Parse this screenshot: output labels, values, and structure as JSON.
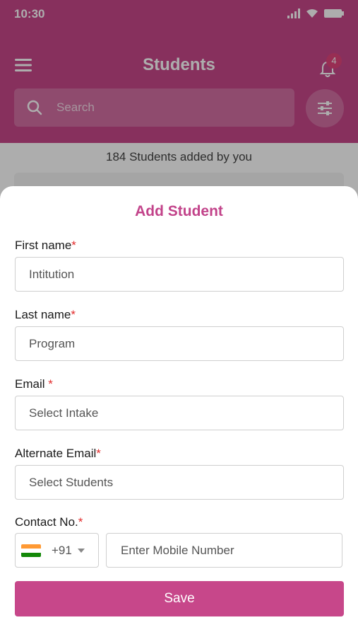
{
  "status_bar": {
    "time": "10:30"
  },
  "header": {
    "title": "Students",
    "notification_count": "4",
    "search_placeholder": "Search"
  },
  "summary": {
    "added_text": "184 Students added by you"
  },
  "sheet": {
    "title": "Add Student",
    "fields": [
      {
        "label": "First name",
        "required_mark": "*",
        "placeholder": "Intitution"
      },
      {
        "label": "Last name",
        "required_mark": "*",
        "placeholder": "Program"
      },
      {
        "label": "Email ",
        "required_mark": "*",
        "placeholder": "Select Intake"
      },
      {
        "label": "Alternate Email",
        "required_mark": "*",
        "placeholder": "Select Students"
      }
    ],
    "contact": {
      "label": "Contact No.",
      "required_mark": "*",
      "country_code": "+91",
      "placeholder": "Enter Mobile Number"
    },
    "save_label": "Save"
  },
  "colors": {
    "brand": "#c7478a",
    "required": "#e22c2c"
  },
  "icons": [
    "menu-icon",
    "bell-icon",
    "search-icon",
    "filter-icon",
    "india-flag-icon",
    "caret-down-icon"
  ]
}
